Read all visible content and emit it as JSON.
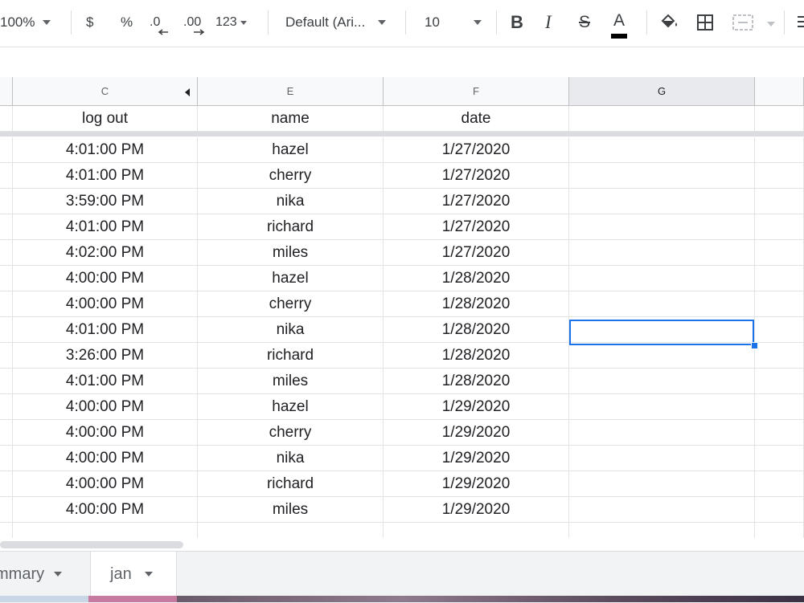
{
  "toolbar": {
    "zoom": "100%",
    "currency": "$",
    "percent": "%",
    "decrease_decimal": ".0",
    "increase_decimal": ".00",
    "more_formats": "123",
    "font": "Default (Ari...",
    "font_size": "10",
    "bold": "B",
    "italic": "I",
    "strikethrough": "S",
    "text_color": "A",
    "text_color_value": "#000000"
  },
  "columns": [
    "C",
    "E",
    "F",
    "G"
  ],
  "header_row": {
    "c": "log out",
    "e": "name",
    "f": "date",
    "g": ""
  },
  "rows": [
    {
      "c": "4:01:00 PM",
      "e": "hazel",
      "f": "1/27/2020"
    },
    {
      "c": "4:01:00 PM",
      "e": "cherry",
      "f": "1/27/2020"
    },
    {
      "c": "3:59:00 PM",
      "e": "nika",
      "f": "1/27/2020"
    },
    {
      "c": "4:01:00 PM",
      "e": "richard",
      "f": "1/27/2020"
    },
    {
      "c": "4:02:00 PM",
      "e": "miles",
      "f": "1/27/2020"
    },
    {
      "c": "4:00:00 PM",
      "e": "hazel",
      "f": "1/28/2020"
    },
    {
      "c": "4:00:00 PM",
      "e": "cherry",
      "f": "1/28/2020"
    },
    {
      "c": "4:01:00 PM",
      "e": "nika",
      "f": "1/28/2020"
    },
    {
      "c": "3:26:00 PM",
      "e": "richard",
      "f": "1/28/2020"
    },
    {
      "c": "4:01:00 PM",
      "e": "miles",
      "f": "1/28/2020"
    },
    {
      "c": "4:00:00 PM",
      "e": "hazel",
      "f": "1/29/2020"
    },
    {
      "c": "4:00:00 PM",
      "e": "cherry",
      "f": "1/29/2020"
    },
    {
      "c": "4:00:00 PM",
      "e": "nika",
      "f": "1/29/2020"
    },
    {
      "c": "4:00:00 PM",
      "e": "richard",
      "f": "1/29/2020"
    },
    {
      "c": "4:00:00 PM",
      "e": "miles",
      "f": "1/29/2020"
    }
  ],
  "sheet_tabs": [
    {
      "label": "mmary",
      "active": false
    },
    {
      "label": "jan",
      "active": true
    }
  ],
  "colors": {
    "selection": "#1a73e8",
    "header_bg": "#f8f9fa"
  }
}
